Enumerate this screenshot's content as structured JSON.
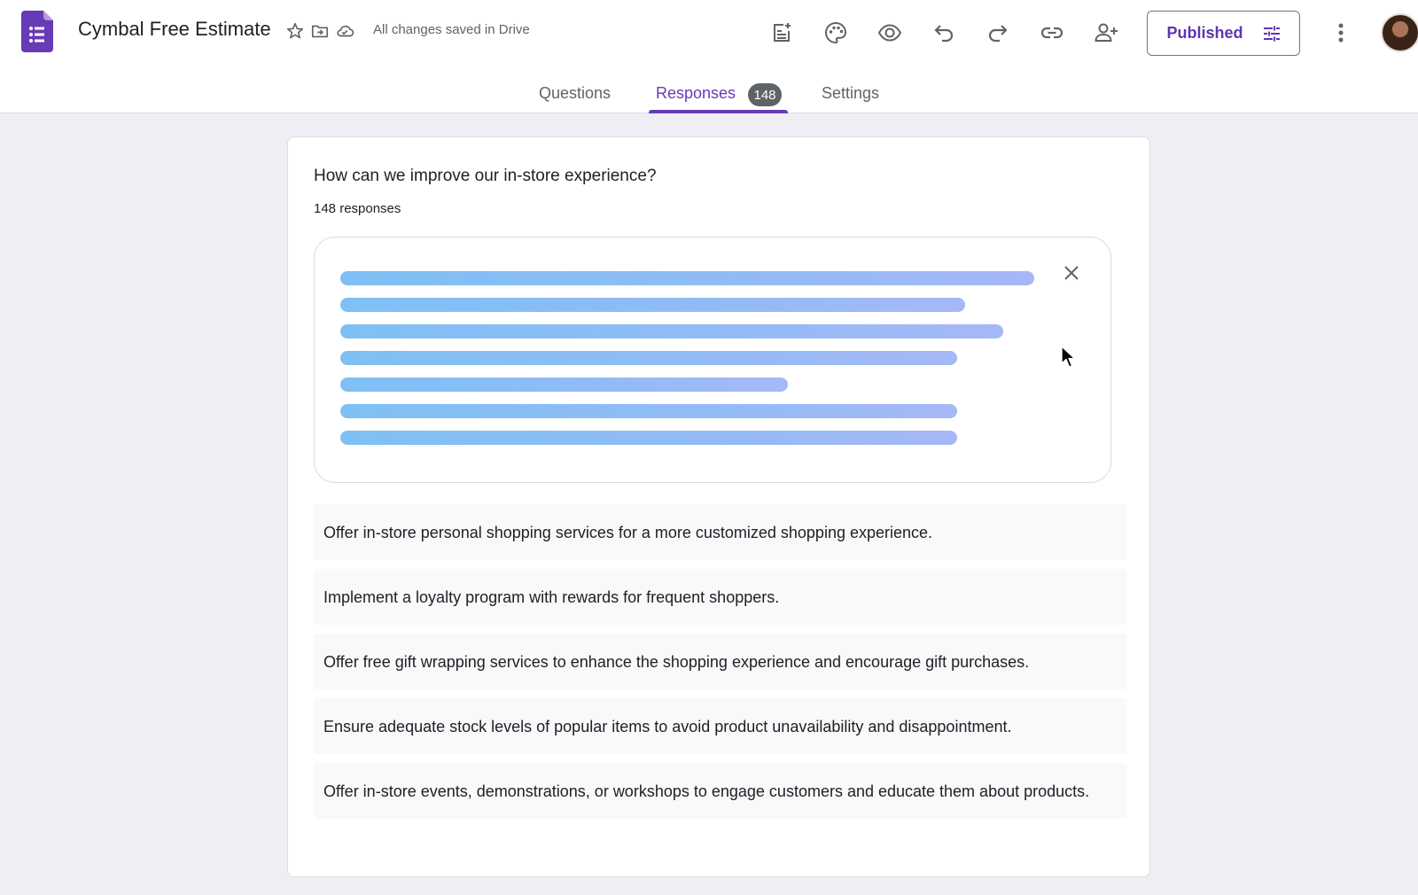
{
  "header": {
    "doc_title": "Cymbal Free Estimate",
    "save_status": "All changes saved in Drive",
    "publish_label": "Published"
  },
  "tabs": [
    {
      "label": "Questions",
      "active": false
    },
    {
      "label": "Responses",
      "active": true,
      "badge": "148"
    },
    {
      "label": "Settings",
      "active": false
    }
  ],
  "question": {
    "title": "How can we improve our in-store experience?",
    "response_count": "148 responses"
  },
  "summary": {
    "state": "generating",
    "line_fractions": [
      0.9,
      0.81,
      0.86,
      0.8,
      0.58,
      0.8,
      0.8
    ]
  },
  "responses": [
    "Offer in-store personal shopping services for a more customized shopping experience.",
    "Implement a loyalty program with rewards for frequent shoppers.",
    "Offer free gift wrapping services to enhance the shopping experience and encourage gift purchases.",
    "Ensure adequate stock levels of popular items to avoid product unavailability and disappointment.",
    "Offer in-store events, demonstrations, or workshops to engage customers and educate them about products."
  ],
  "colors": {
    "accent": "#673ab7",
    "app_icon": "#673ab7",
    "summary_bar_start": "#7ec0f5",
    "summary_bar_end": "#a6b8f7"
  },
  "icons": [
    "forms-app-icon",
    "star-icon",
    "move-to-folder-icon",
    "cloud-saved-icon",
    "add-summary-icon",
    "palette-icon",
    "preview-eye-icon",
    "undo-icon",
    "redo-icon",
    "link-icon",
    "add-collaborator-icon",
    "tune-icon",
    "more-vert-icon",
    "close-icon"
  ]
}
